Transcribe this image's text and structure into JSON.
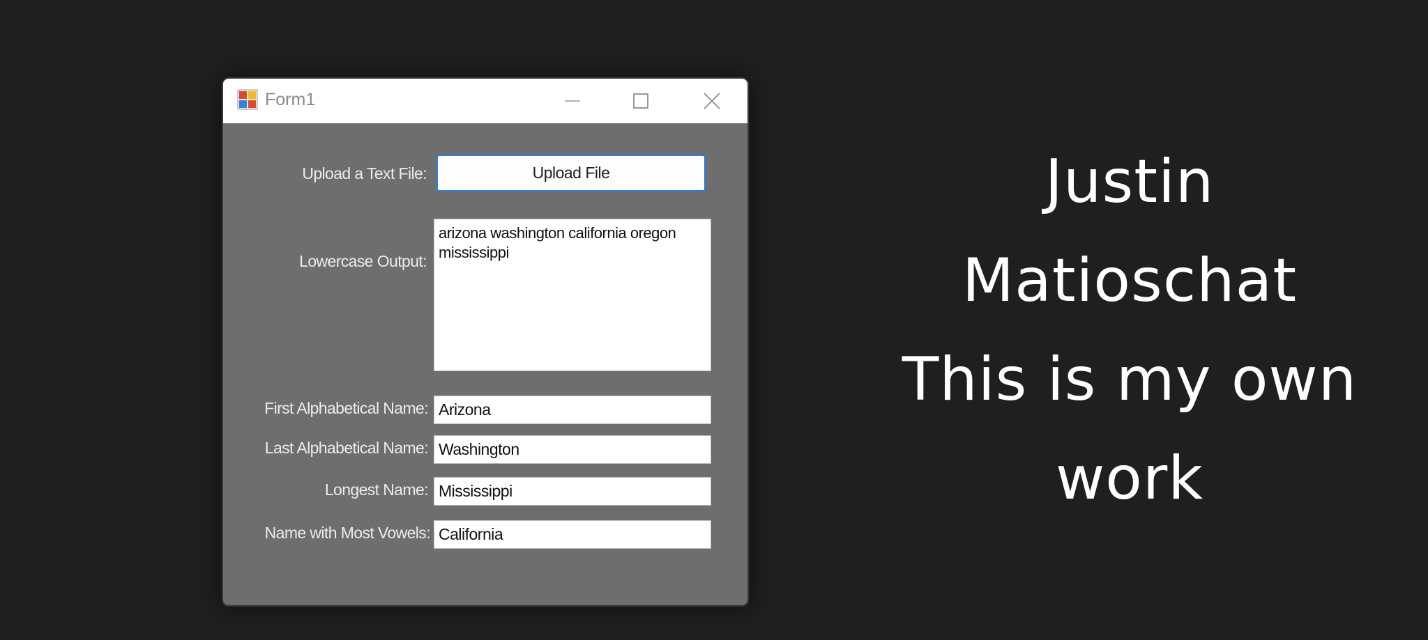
{
  "window": {
    "title": "Form1",
    "icons": {
      "app": "app-icon",
      "minimize": "minimize-icon",
      "maximize": "maximize-icon",
      "close": "close-icon"
    }
  },
  "form": {
    "upload_label": "Upload a Text File:",
    "upload_button": "Upload File",
    "lowercase_label": "Lowercase Output:",
    "lowercase_line1": "arizona washington california oregon",
    "lowercase_line2": "mississippi",
    "first_label": "First Alphabetical Name:",
    "first_value": "Arizona",
    "last_label": "Last Alphabetical Name:",
    "last_value": "Washington",
    "longest_label": "Longest Name:",
    "longest_value": "Mississippi",
    "vowels_label": "Name with Most Vowels:",
    "vowels_value": "California"
  },
  "side": {
    "line1": "Justin",
    "line2": "Matioschat",
    "line3": "This is my own",
    "line4": "work"
  },
  "colors": {
    "background": "#1f1f1f",
    "form_body": "#6e6e6e",
    "button_border": "#2f7bd8"
  }
}
